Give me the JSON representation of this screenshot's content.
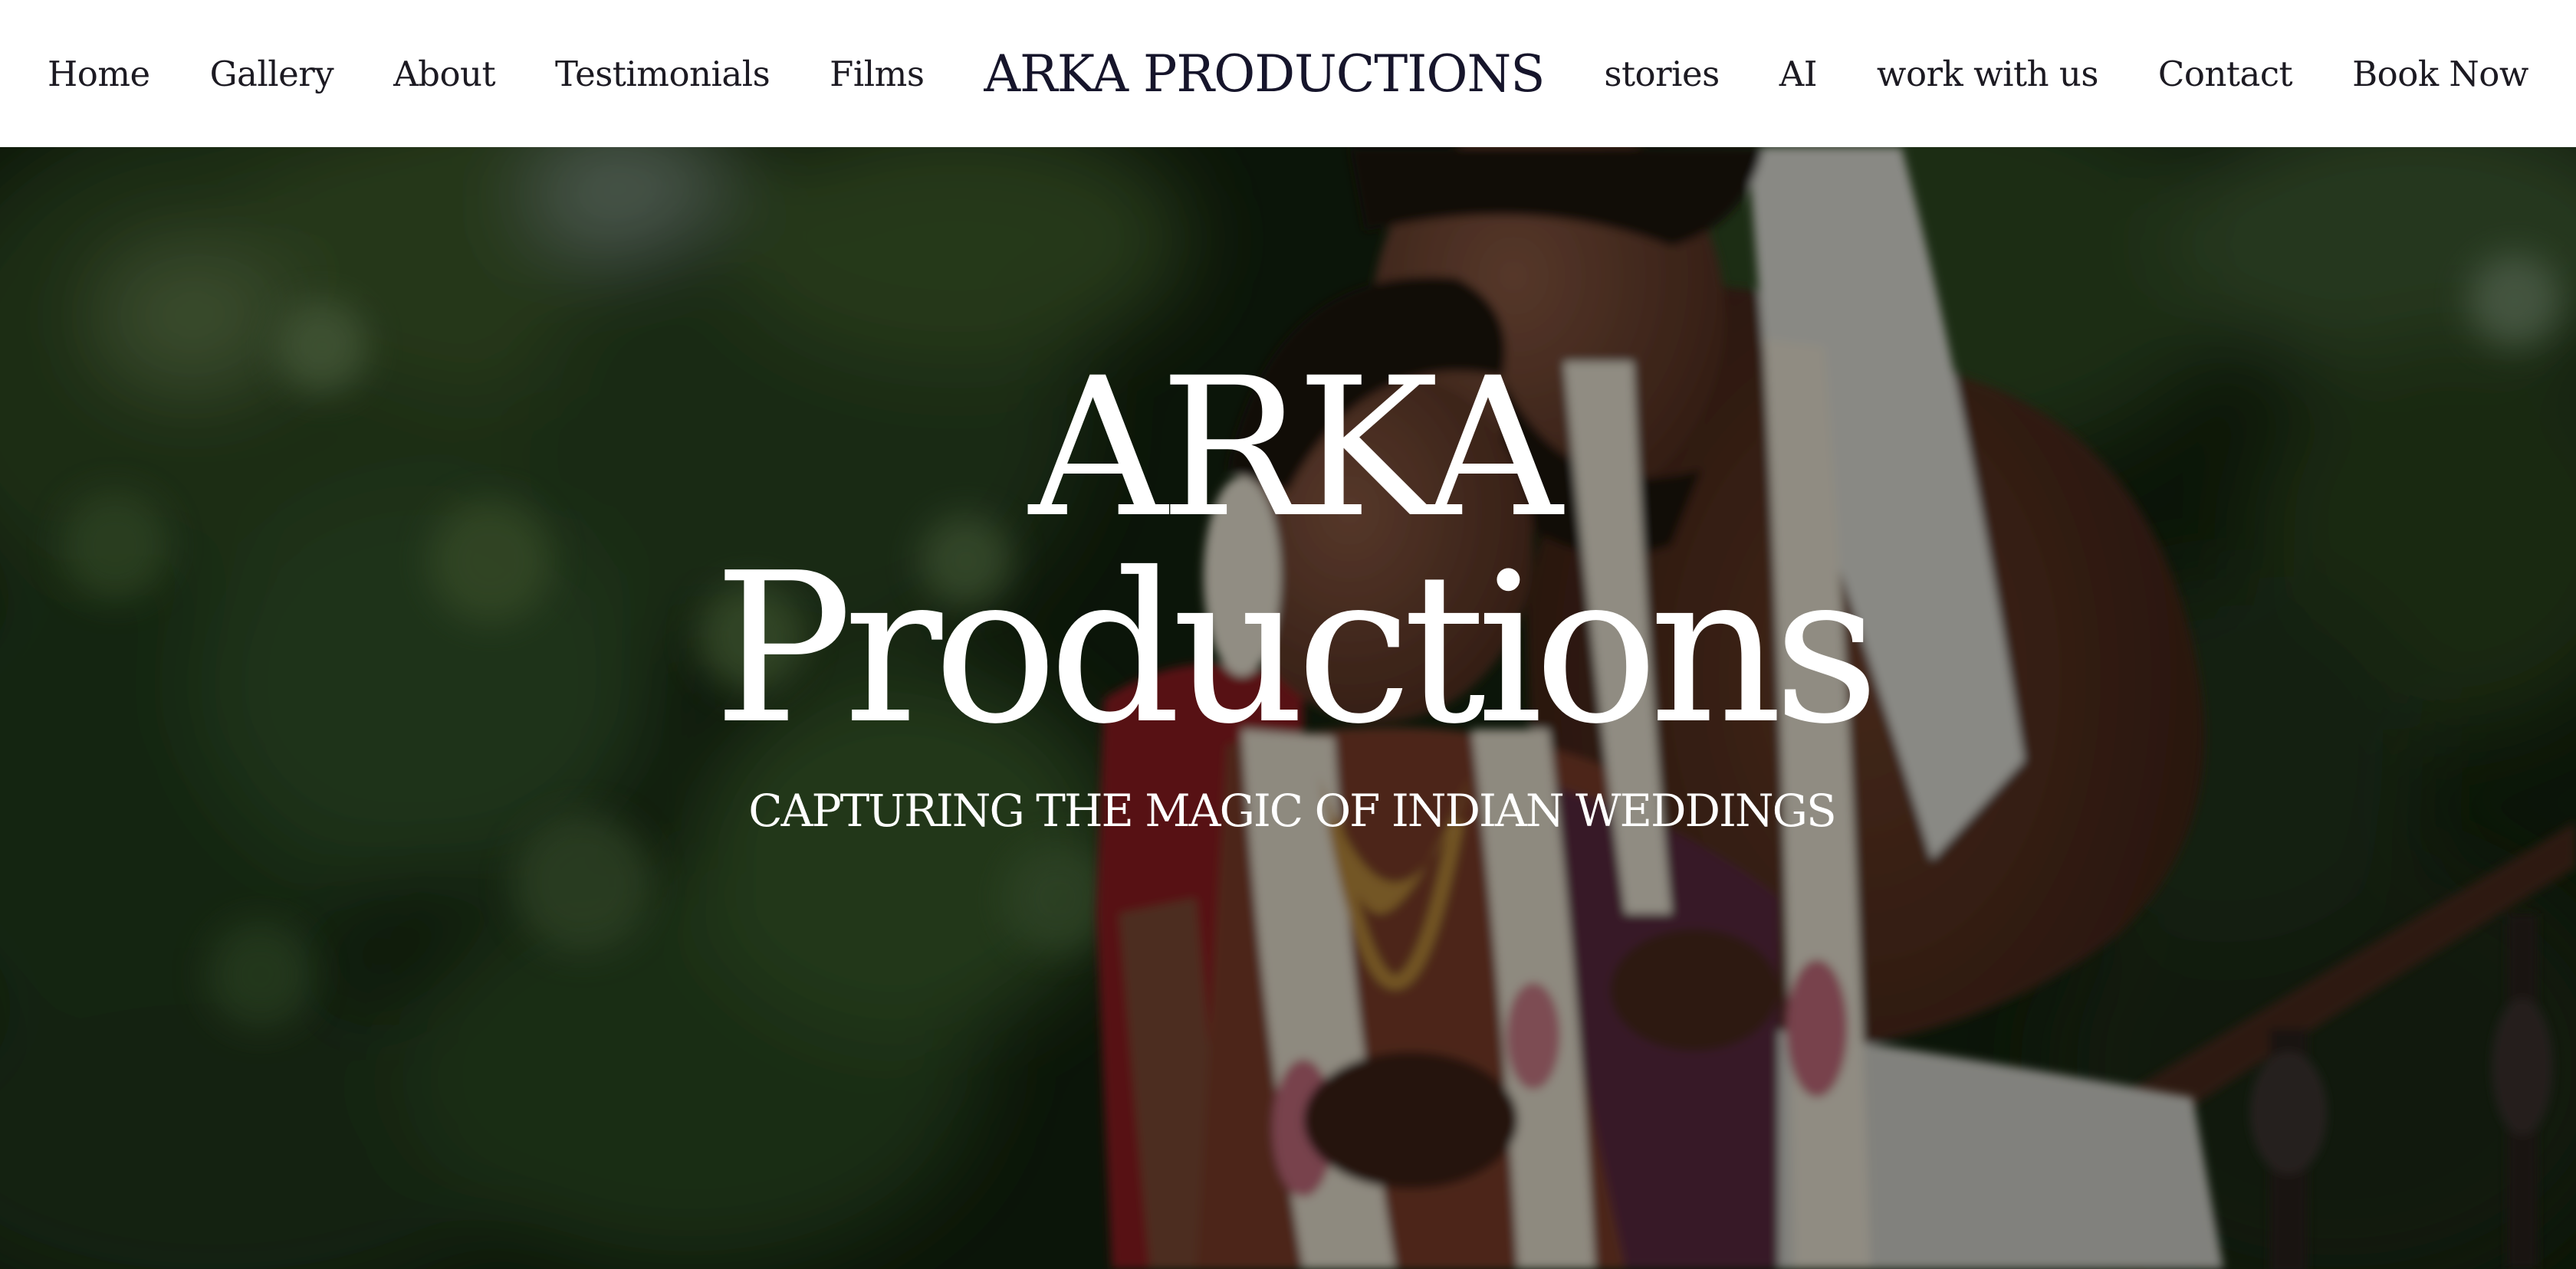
{
  "header": {
    "brand": "ARKA PRODUCTIONS",
    "nav_left": [
      "Home",
      "Gallery",
      "About",
      "Testimonials",
      "Films"
    ],
    "nav_right": [
      "stories",
      "AI",
      "work with us",
      "Contact",
      "Book Now"
    ]
  },
  "hero": {
    "title_line1": "ARKA",
    "title_line2": "Productions",
    "subtitle": "CAPTURING THE MAGIC OF INDIAN WEDDINGS"
  },
  "colors": {
    "nav_text": "#1c1a22",
    "hero_text": "#ffffff",
    "foliage_dark": "#0f1a0c"
  }
}
